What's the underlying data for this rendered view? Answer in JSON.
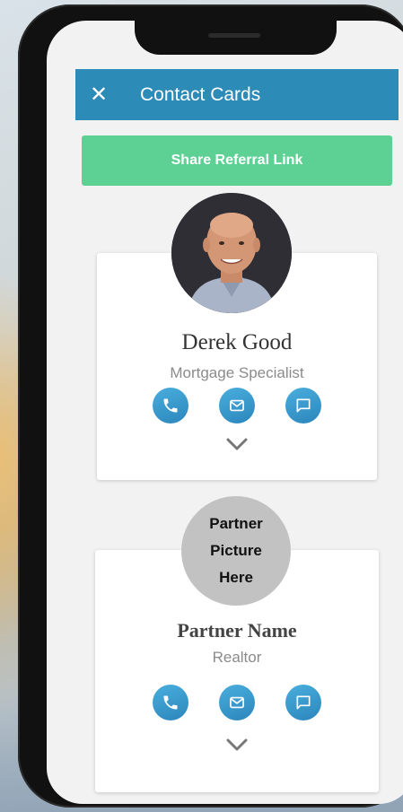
{
  "app_bar": {
    "close_label": "✕",
    "title": "Contact Cards"
  },
  "share_button": {
    "label": "Share Referral Link"
  },
  "cards": [
    {
      "name": "Derek Good",
      "role": "Mortgage Specialist",
      "avatar": "profile-photo"
    },
    {
      "name": "Partner Name",
      "role": "Realtor",
      "avatar_placeholder": [
        "Partner",
        "Picture",
        "Here"
      ]
    }
  ],
  "colors": {
    "app_bar": "#2d8bb7",
    "share_button": "#5dd194",
    "action_button": "#3a9ccf"
  },
  "icons": {
    "close": "close-icon",
    "phone": "phone-icon",
    "email": "mail-icon",
    "message": "message-icon",
    "expand": "chevron-down-icon"
  }
}
